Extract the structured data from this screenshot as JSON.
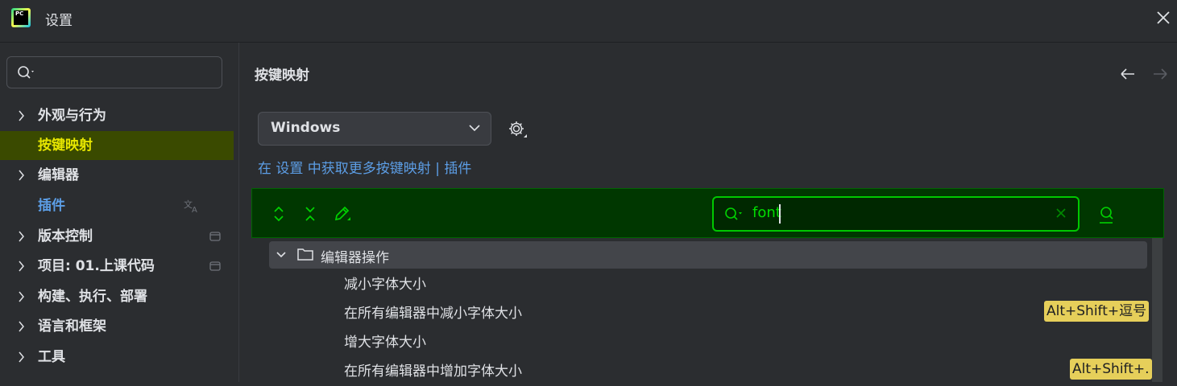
{
  "window": {
    "title": "设置"
  },
  "sidebar": {
    "search_placeholder": "",
    "items": [
      {
        "label": "外观与行为",
        "expandable": true
      },
      {
        "label": "按键映射",
        "selected": true
      },
      {
        "label": "编辑器",
        "expandable": true
      },
      {
        "label": "插件",
        "tail_icon": "translate-icon"
      },
      {
        "label": "版本控制",
        "expandable": true,
        "tail_icon": "window-icon"
      },
      {
        "label": "项目: 01.上课代码",
        "expandable": true,
        "tail_icon": "window-icon"
      },
      {
        "label": "构建、执行、部署",
        "expandable": true
      },
      {
        "label": "语言和框架",
        "expandable": true
      },
      {
        "label": "工具",
        "expandable": true
      }
    ]
  },
  "main": {
    "title": "按键映射",
    "keymap_select": {
      "value": "Windows"
    },
    "more_link": "在 设置 中获取更多按键映射 | 插件",
    "search": {
      "value": "font",
      "placeholder": ""
    },
    "tree": {
      "group": "编辑器操作",
      "rows": [
        {
          "label": "减小字体大小",
          "shortcut": ""
        },
        {
          "label": "在所有编辑器中减小字体大小",
          "shortcut": "Alt+Shift+逗号"
        },
        {
          "label": "增大字体大小",
          "shortcut": ""
        },
        {
          "label": "在所有编辑器中增加字体大小",
          "shortcut": "Alt+Shift+."
        }
      ]
    }
  },
  "colors": {
    "background": "#2b2d30",
    "selection": "#3a4a00",
    "selected_text": "#e6e600",
    "link": "#5c9ee6",
    "toolbar_bg": "#003700",
    "search_border": "#00c800",
    "shortcut_badge": "#e6cf5a"
  }
}
